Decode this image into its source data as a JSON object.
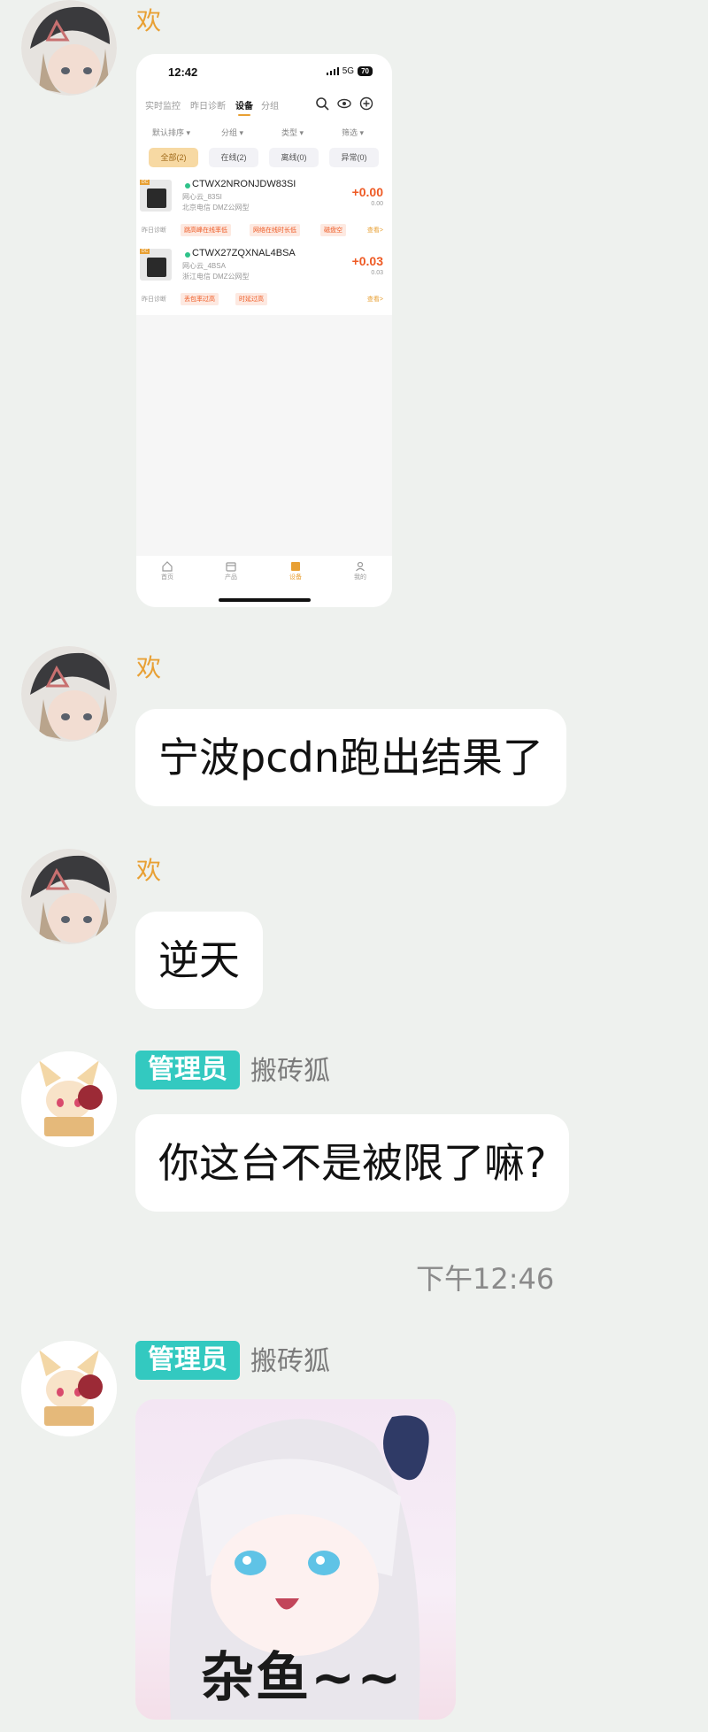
{
  "messages": [
    {
      "sender": "欢",
      "type": "image"
    },
    {
      "sender": "欢",
      "type": "text",
      "text": "宁波pcdn跑出结果了"
    },
    {
      "sender": "欢",
      "type": "text",
      "text": "逆天"
    },
    {
      "sender": "搬砖狐",
      "badge": "管理员",
      "type": "text",
      "text": "你这台不是被限了嘛?"
    },
    {
      "sender": "搬砖狐",
      "badge": "管理员",
      "type": "sticker",
      "sticker_text": "杂鱼~~"
    }
  ],
  "timestamp": "下午12:46",
  "phone": {
    "time": "12:42",
    "network": "5G",
    "battery": "70",
    "tabs": [
      "实时监控",
      "昨日诊断",
      "设备",
      "分组"
    ],
    "active_tab": "设备",
    "filters": [
      "默认排序 ▾",
      "分组 ▾",
      "类型 ▾",
      "筛选 ▾"
    ],
    "pills": [
      "全部(2)",
      "在线(2)",
      "离线(0)",
      "异常(0)"
    ],
    "devices": [
      {
        "tag": "DC",
        "name": "CTWX2NRONJDW83SI",
        "sub1": "网心云_83SI",
        "sub2": "北京电信 DMZ公网型",
        "value": "+0.00",
        "value2": "0.00",
        "footer": "昨日诊断",
        "chips": [
          "跳高峰在线率低",
          "网络在线时长低",
          "磁盘空"
        ],
        "more": "查看>"
      },
      {
        "tag": "DC",
        "name": "CTWX27ZQXNAL4BSA",
        "sub1": "网心云_4BSA",
        "sub2": "浙江电信 DMZ公网型",
        "value": "+0.03",
        "value2": "0.03",
        "footer": "昨日诊断",
        "chips": [
          "丢包率过高",
          "时延过高"
        ],
        "more": "查看>"
      }
    ],
    "nav": [
      "首页",
      "产品",
      "设备",
      "我的"
    ],
    "active_nav": "设备"
  }
}
